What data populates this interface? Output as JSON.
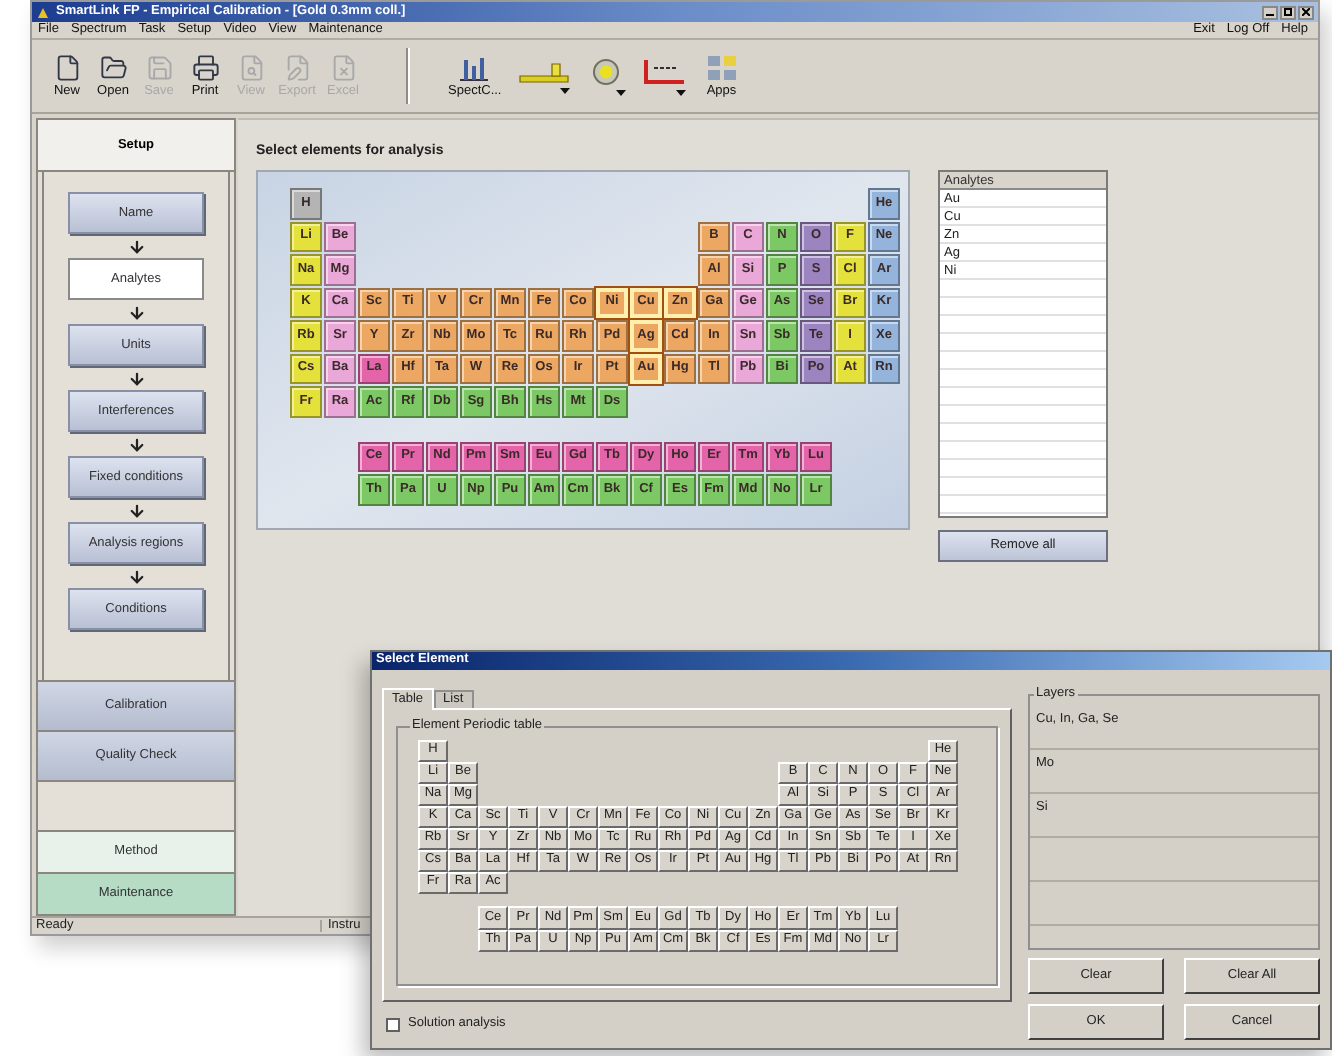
{
  "window": {
    "title": "SmartLink FP - Empirical Calibration - [Gold 0.3mm coll.]"
  },
  "menu": [
    "File",
    "Spectrum",
    "Task",
    "Setup",
    "Video",
    "View",
    "Maintenance"
  ],
  "menu_right": [
    "Exit",
    "Log Off",
    "Help"
  ],
  "toolbar": {
    "file_tools": [
      {
        "kind": "new",
        "label": "New",
        "disabled": false
      },
      {
        "kind": "open",
        "label": "Open",
        "disabled": false
      },
      {
        "kind": "save",
        "label": "Save",
        "disabled": true
      },
      {
        "kind": "print",
        "label": "Print",
        "disabled": false
      },
      {
        "kind": "view",
        "label": "View",
        "disabled": true
      },
      {
        "kind": "export",
        "label": "Export",
        "disabled": true
      },
      {
        "kind": "excel",
        "label": "Excel",
        "disabled": true
      }
    ],
    "app_tools": [
      {
        "kind": "spectrum",
        "label": "SpectC...",
        "dropdown": false
      },
      {
        "kind": "ruler",
        "dropdown": true
      },
      {
        "kind": "disk",
        "dropdown": true
      },
      {
        "kind": "axes",
        "dropdown": true
      },
      {
        "kind": "apps",
        "label": "Apps",
        "dropdown": false
      }
    ]
  },
  "sidebar": {
    "header": {
      "label": "Setup",
      "selected": true
    },
    "steps": [
      {
        "label": "Name",
        "selected": false
      },
      {
        "label": "Analytes",
        "selected": true
      },
      {
        "label": "Units",
        "selected": false
      },
      {
        "label": "Interferences",
        "selected": false
      },
      {
        "label": "Fixed conditions",
        "selected": false
      },
      {
        "label": "Analysis regions",
        "selected": false
      },
      {
        "label": "Conditions",
        "selected": false
      }
    ],
    "sections": [
      {
        "label": "Calibration",
        "selected": false
      },
      {
        "label": "Quality Check",
        "selected": false
      }
    ],
    "bottom_tabs": [
      {
        "label": "Method",
        "selected": true
      },
      {
        "label": "Maintenance",
        "selected": false
      }
    ]
  },
  "main": {
    "heading": "Select elements for analysis",
    "table": {
      "rows": [
        {
          "left": [
            {
              "symbol": "H",
              "color": "#b4b4b4",
              "selected": false
            }
          ],
          "right": [
            {
              "symbol": "He",
              "color": "#94b4dc",
              "selected": false
            }
          ]
        },
        {
          "left": [
            {
              "symbol": "Li",
              "color": "#e4e03c",
              "selected": false
            },
            {
              "symbol": "Be",
              "color": "#eaa8d8",
              "selected": false
            }
          ],
          "right": [
            {
              "symbol": "B",
              "color": "#eca862",
              "selected": false
            },
            {
              "symbol": "C",
              "color": "#eaa8d8",
              "selected": false
            },
            {
              "symbol": "N",
              "color": "#7cc864",
              "selected": false
            },
            {
              "symbol": "O",
              "color": "#9c84c0",
              "selected": false
            },
            {
              "symbol": "F",
              "color": "#e4e03c",
              "selected": false
            },
            {
              "symbol": "Ne",
              "color": "#94b4dc",
              "selected": false
            }
          ]
        },
        {
          "left": [
            {
              "symbol": "Na",
              "color": "#e4e03c",
              "selected": false
            },
            {
              "symbol": "Mg",
              "color": "#eaa8d8",
              "selected": false
            }
          ],
          "right": [
            {
              "symbol": "Al",
              "color": "#eca862",
              "selected": false
            },
            {
              "symbol": "Si",
              "color": "#eaa8d8",
              "selected": false
            },
            {
              "symbol": "P",
              "color": "#7cc864",
              "selected": false
            },
            {
              "symbol": "S",
              "color": "#9c84c0",
              "selected": false
            },
            {
              "symbol": "Cl",
              "color": "#e4e03c",
              "selected": false
            },
            {
              "symbol": "Ar",
              "color": "#94b4dc",
              "selected": false
            }
          ]
        },
        {
          "left": [
            {
              "symbol": "K",
              "color": "#e4e03c",
              "selected": false
            },
            {
              "symbol": "Ca",
              "color": "#eaa8d8",
              "selected": false
            },
            {
              "symbol": "Sc",
              "color": "#eca862",
              "selected": false
            },
            {
              "symbol": "Ti",
              "color": "#eca862",
              "selected": false
            },
            {
              "symbol": "V",
              "color": "#eca862",
              "selected": false
            },
            {
              "symbol": "Cr",
              "color": "#eca862",
              "selected": false
            },
            {
              "symbol": "Mn",
              "color": "#eca862",
              "selected": false
            },
            {
              "symbol": "Fe",
              "color": "#eca862",
              "selected": false
            },
            {
              "symbol": "Co",
              "color": "#eca862",
              "selected": false
            },
            {
              "symbol": "Ni",
              "color": "#eca862",
              "selected": true
            },
            {
              "symbol": "Cu",
              "color": "#eca862",
              "selected": true
            },
            {
              "symbol": "Zn",
              "color": "#eca862",
              "selected": true
            },
            {
              "symbol": "Ga",
              "color": "#eca862",
              "selected": false
            },
            {
              "symbol": "Ge",
              "color": "#eaa8d8",
              "selected": false
            },
            {
              "symbol": "As",
              "color": "#7cc864",
              "selected": false
            },
            {
              "symbol": "Se",
              "color": "#9c84c0",
              "selected": false
            },
            {
              "symbol": "Br",
              "color": "#e4e03c",
              "selected": false
            },
            {
              "symbol": "Kr",
              "color": "#94b4dc",
              "selected": false
            }
          ],
          "right": []
        },
        {
          "left": [
            {
              "symbol": "Rb",
              "color": "#e4e03c",
              "selected": false
            },
            {
              "symbol": "Sr",
              "color": "#eaa8d8",
              "selected": false
            },
            {
              "symbol": "Y",
              "color": "#eca862",
              "selected": false
            },
            {
              "symbol": "Zr",
              "color": "#eca862",
              "selected": false
            },
            {
              "symbol": "Nb",
              "color": "#eca862",
              "selected": false
            },
            {
              "symbol": "Mo",
              "color": "#eca862",
              "selected": false
            },
            {
              "symbol": "Tc",
              "color": "#eca862",
              "selected": false
            },
            {
              "symbol": "Ru",
              "color": "#eca862",
              "selected": false
            },
            {
              "symbol": "Rh",
              "color": "#eca862",
              "selected": false
            },
            {
              "symbol": "Pd",
              "color": "#eca862",
              "selected": false
            },
            {
              "symbol": "Ag",
              "color": "#eca862",
              "selected": true
            },
            {
              "symbol": "Cd",
              "color": "#eca862",
              "selected": false
            },
            {
              "symbol": "In",
              "color": "#eca862",
              "selected": false
            },
            {
              "symbol": "Sn",
              "color": "#eaa8d8",
              "selected": false
            },
            {
              "symbol": "Sb",
              "color": "#7cc864",
              "selected": false
            },
            {
              "symbol": "Te",
              "color": "#9c84c0",
              "selected": false
            },
            {
              "symbol": "I",
              "color": "#e4e03c",
              "selected": false
            },
            {
              "symbol": "Xe",
              "color": "#94b4dc",
              "selected": false
            }
          ],
          "right": []
        },
        {
          "left": [
            {
              "symbol": "Cs",
              "color": "#e4e03c",
              "selected": false
            },
            {
              "symbol": "Ba",
              "color": "#eaa8d8",
              "selected": false
            },
            {
              "symbol": "La",
              "color": "#e464aa",
              "selected": false
            },
            {
              "symbol": "Hf",
              "color": "#eca862",
              "selected": false
            },
            {
              "symbol": "Ta",
              "color": "#eca862",
              "selected": false
            },
            {
              "symbol": "W",
              "color": "#eca862",
              "selected": false
            },
            {
              "symbol": "Re",
              "color": "#eca862",
              "selected": false
            },
            {
              "symbol": "Os",
              "color": "#eca862",
              "selected": false
            },
            {
              "symbol": "Ir",
              "color": "#eca862",
              "selected": false
            },
            {
              "symbol": "Pt",
              "color": "#eca862",
              "selected": false
            },
            {
              "symbol": "Au",
              "color": "#eca862",
              "selected": true
            },
            {
              "symbol": "Hg",
              "color": "#eca862",
              "selected": false
            },
            {
              "symbol": "Tl",
              "color": "#eca862",
              "selected": false
            },
            {
              "symbol": "Pb",
              "color": "#eaa8d8",
              "selected": false
            },
            {
              "symbol": "Bi",
              "color": "#7cc864",
              "selected": false
            },
            {
              "symbol": "Po",
              "color": "#9c84c0",
              "selected": false
            },
            {
              "symbol": "At",
              "color": "#e4e03c",
              "selected": false
            },
            {
              "symbol": "Rn",
              "color": "#94b4dc",
              "selected": false
            }
          ],
          "right": []
        },
        {
          "left": [
            {
              "symbol": "Fr",
              "color": "#e4e03c",
              "selected": false
            },
            {
              "symbol": "Ra",
              "color": "#eaa8d8",
              "selected": false
            },
            {
              "symbol": "Ac",
              "color": "#7cc864",
              "selected": false
            },
            {
              "symbol": "Rf",
              "color": "#7cc864",
              "selected": false
            },
            {
              "symbol": "Db",
              "color": "#7cc864",
              "selected": false
            },
            {
              "symbol": "Sg",
              "color": "#7cc864",
              "selected": false
            },
            {
              "symbol": "Bh",
              "color": "#7cc864",
              "selected": false
            },
            {
              "symbol": "Hs",
              "color": "#7cc864",
              "selected": false
            },
            {
              "symbol": "Mt",
              "color": "#7cc864",
              "selected": false
            },
            {
              "symbol": "Ds",
              "color": "#7cc864",
              "selected": false
            }
          ],
          "right": []
        }
      ],
      "series_rows": [
        [
          {
            "symbol": "Ce",
            "color": "#e464aa",
            "selected": false
          },
          {
            "symbol": "Pr",
            "color": "#e464aa",
            "selected": false
          },
          {
            "symbol": "Nd",
            "color": "#e464aa",
            "selected": false
          },
          {
            "symbol": "Pm",
            "color": "#e464aa",
            "selected": false
          },
          {
            "symbol": "Sm",
            "color": "#e464aa",
            "selected": false
          },
          {
            "symbol": "Eu",
            "color": "#e464aa",
            "selected": false
          },
          {
            "symbol": "Gd",
            "color": "#e464aa",
            "selected": false
          },
          {
            "symbol": "Tb",
            "color": "#e464aa",
            "selected": false
          },
          {
            "symbol": "Dy",
            "color": "#e464aa",
            "selected": false
          },
          {
            "symbol": "Ho",
            "color": "#e464aa",
            "selected": false
          },
          {
            "symbol": "Er",
            "color": "#e464aa",
            "selected": false
          },
          {
            "symbol": "Tm",
            "color": "#e464aa",
            "selected": false
          },
          {
            "symbol": "Yb",
            "color": "#e464aa",
            "selected": false
          },
          {
            "symbol": "Lu",
            "color": "#e464aa",
            "selected": false
          }
        ],
        [
          {
            "symbol": "Th",
            "color": "#7cc864",
            "selected": false
          },
          {
            "symbol": "Pa",
            "color": "#7cc864",
            "selected": false
          },
          {
            "symbol": "U",
            "color": "#7cc864",
            "selected": false
          },
          {
            "symbol": "Np",
            "color": "#7cc864",
            "selected": false
          },
          {
            "symbol": "Pu",
            "color": "#7cc864",
            "selected": false
          },
          {
            "symbol": "Am",
            "color": "#7cc864",
            "selected": false
          },
          {
            "symbol": "Cm",
            "color": "#7cc864",
            "selected": false
          },
          {
            "symbol": "Bk",
            "color": "#7cc864",
            "selected": false
          },
          {
            "symbol": "Cf",
            "color": "#7cc864",
            "selected": false
          },
          {
            "symbol": "Es",
            "color": "#7cc864",
            "selected": false
          },
          {
            "symbol": "Fm",
            "color": "#7cc864",
            "selected": false
          },
          {
            "symbol": "Md",
            "color": "#7cc864",
            "selected": false
          },
          {
            "symbol": "No",
            "color": "#7cc864",
            "selected": false
          },
          {
            "symbol": "Lr",
            "color": "#7cc864",
            "selected": false
          }
        ]
      ]
    },
    "analytes": {
      "header": "Analytes",
      "items": [
        "Au",
        "Cu",
        "Zn",
        "Ag",
        "Ni"
      ]
    },
    "remove_button": "Remove all"
  },
  "status_bar": [
    "Ready",
    "Instru"
  ],
  "dialog": {
    "title": "Select Element",
    "tabs": [
      {
        "label": "Table",
        "selected": true
      },
      {
        "label": "List",
        "selected": false
      }
    ],
    "group_label": "Element Periodic table",
    "rows": [
      {
        "left": [
          "H"
        ],
        "right": [
          "He"
        ]
      },
      {
        "left": [
          "Li",
          "Be"
        ],
        "right": [
          "B",
          "C",
          "N",
          "O",
          "F",
          "Ne"
        ]
      },
      {
        "left": [
          "Na",
          "Mg"
        ],
        "right": [
          "Al",
          "Si",
          "P",
          "S",
          "Cl",
          "Ar"
        ]
      },
      {
        "left": [
          "K",
          "Ca",
          "Sc",
          "Ti",
          "V",
          "Cr",
          "Mn",
          "Fe",
          "Co",
          "Ni",
          "Cu",
          "Zn",
          "Ga",
          "Ge",
          "As",
          "Se",
          "Br",
          "Kr"
        ],
        "right": []
      },
      {
        "left": [
          "Rb",
          "Sr",
          "Y",
          "Zr",
          "Nb",
          "Mo",
          "Tc",
          "Ru",
          "Rh",
          "Pd",
          "Ag",
          "Cd",
          "In",
          "Sn",
          "Sb",
          "Te",
          "I",
          "Xe"
        ],
        "right": []
      },
      {
        "left": [
          "Cs",
          "Ba",
          "La",
          "Hf",
          "Ta",
          "W",
          "Re",
          "Os",
          "Ir",
          "Pt",
          "Au",
          "Hg",
          "Tl",
          "Pb",
          "Bi",
          "Po",
          "At",
          "Rn"
        ],
        "right": []
      },
      {
        "left": [
          "Fr",
          "Ra",
          "Ac"
        ],
        "right": []
      }
    ],
    "series_rows": [
      [
        "Ce",
        "Pr",
        "Nd",
        "Pm",
        "Sm",
        "Eu",
        "Gd",
        "Tb",
        "Dy",
        "Ho",
        "Er",
        "Tm",
        "Yb",
        "Lu"
      ],
      [
        "Th",
        "Pa",
        "U",
        "Np",
        "Pu",
        "Am",
        "Cm",
        "Bk",
        "Cf",
        "Es",
        "Fm",
        "Md",
        "No",
        "Lr"
      ]
    ],
    "layers_label": "Layers",
    "layers": [
      "Cu, In, Ga, Se",
      "Mo",
      "Si"
    ],
    "buttons": [
      "Clear",
      "Clear All",
      "OK",
      "Cancel"
    ],
    "solution_analysis": {
      "label": "Solution analysis",
      "checked": false
    }
  }
}
